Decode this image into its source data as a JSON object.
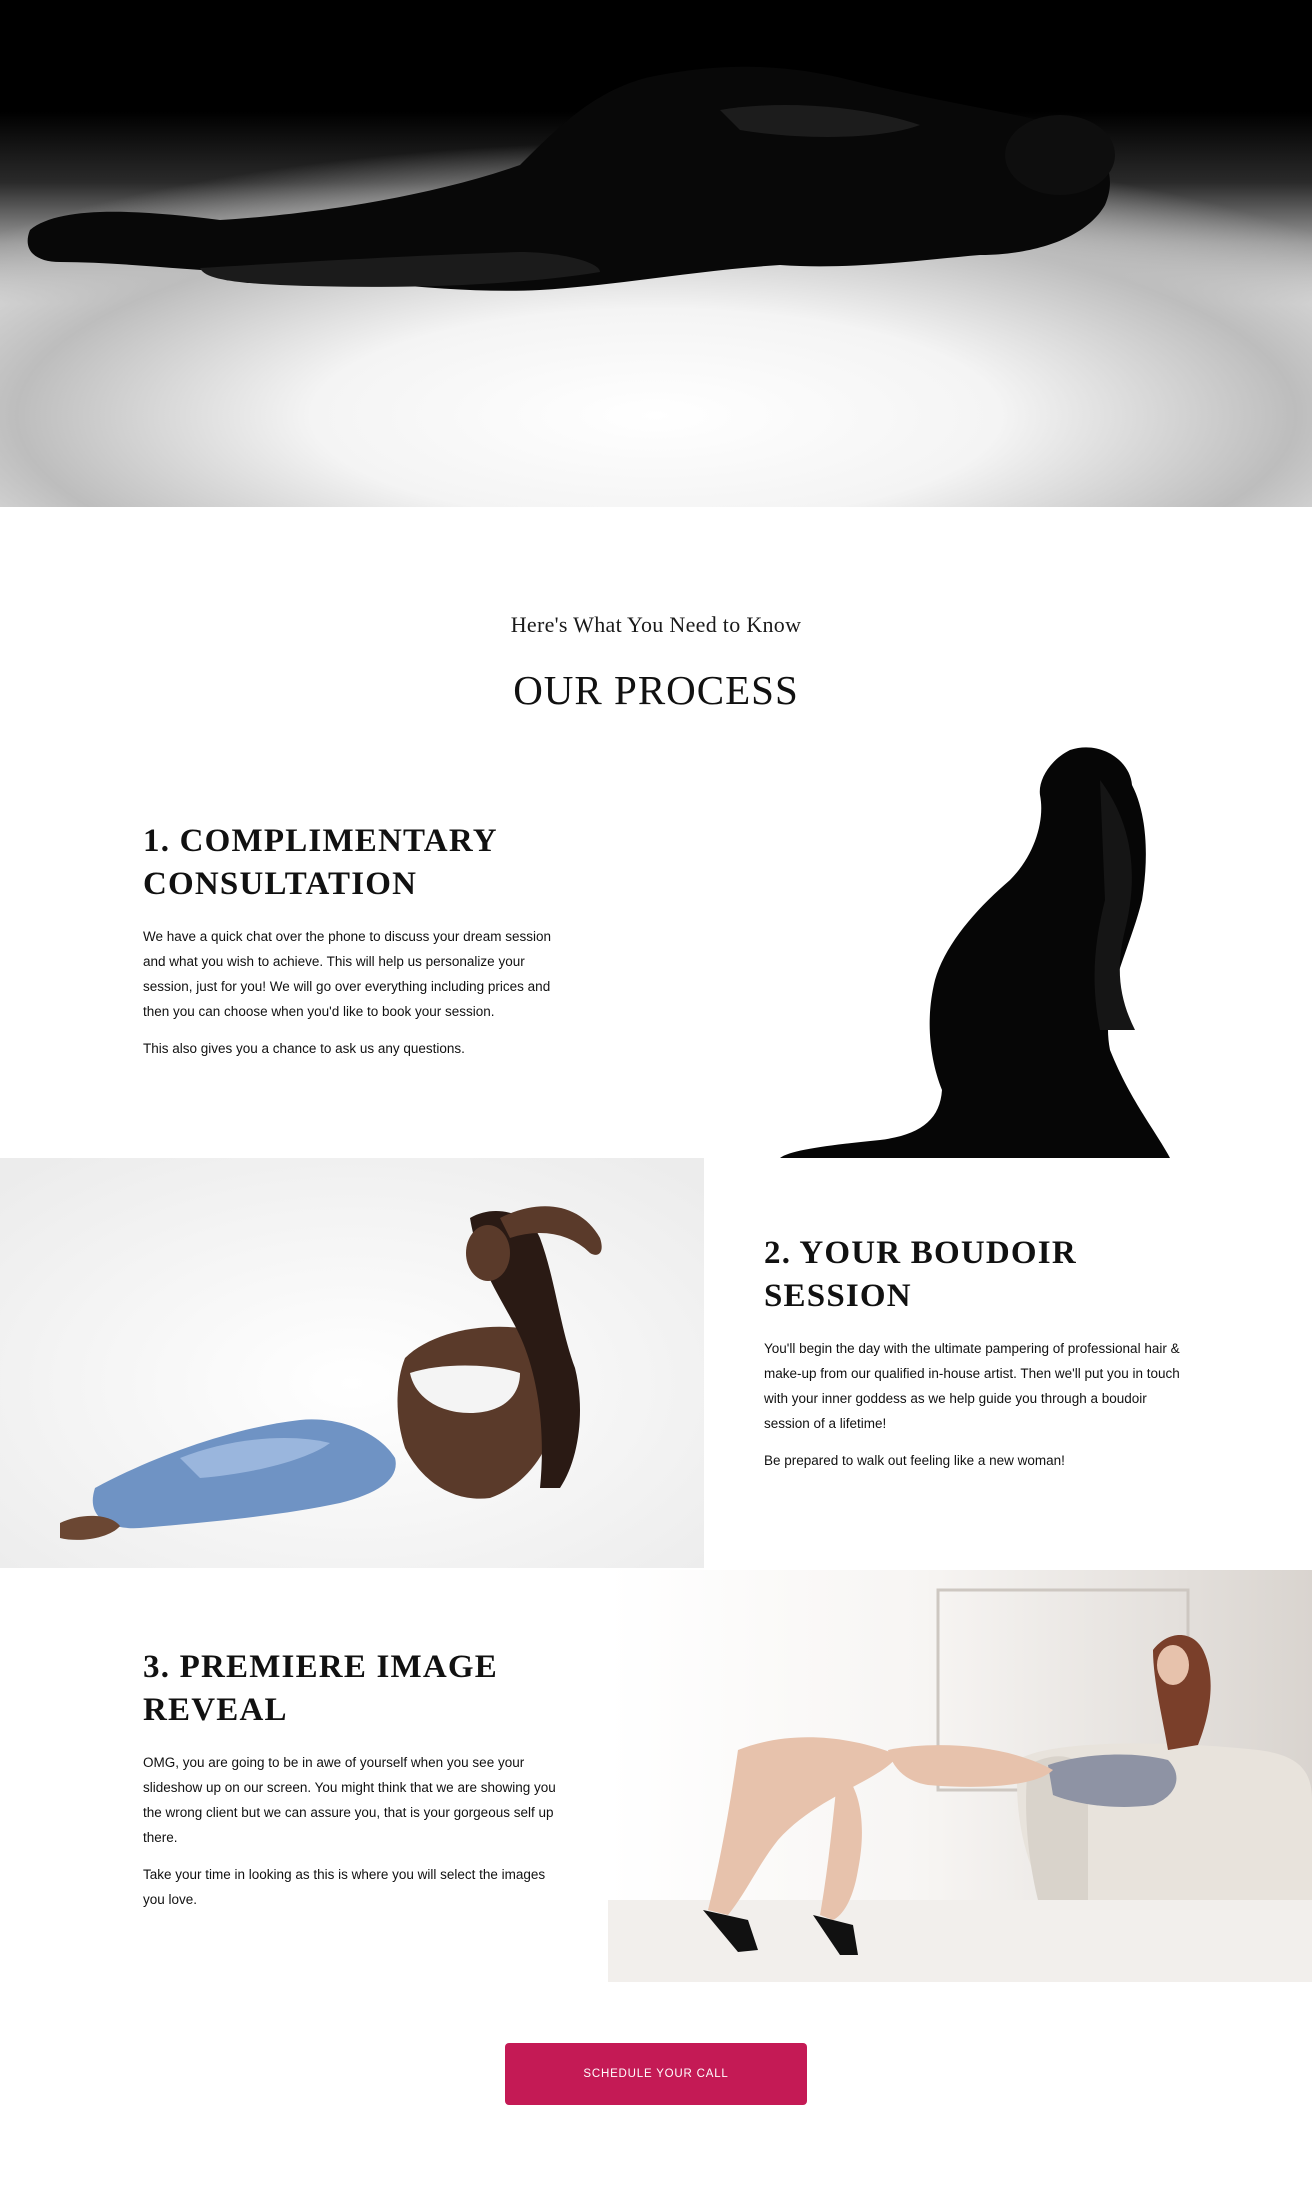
{
  "hero": {
    "image": "boudoir-hero-bw-photo"
  },
  "process": {
    "eyebrow": "Here's What You Need to Know",
    "title": "OUR PROCESS"
  },
  "steps": [
    {
      "title": "1. COMPLIMENTARY CONSULTATION",
      "paragraphs": [
        "We have a quick chat over the phone to discuss your dream session and what you wish to achieve. This will help us personalize your session, just for you! We will go over everything including prices and then you can choose when you'd like to book your session.",
        "This also gives you a chance to ask us any questions."
      ],
      "image": "silhouette-portrait-photo"
    },
    {
      "title": "2. YOUR BOUDOIR SESSION",
      "paragraphs": [
        "You'll begin the day with the ultimate pampering of professional hair & make-up from our qualified in-house artist.  Then we'll put you in touch with your inner goddess as we help guide you through a boudoir session of a lifetime!",
        "Be prepared to walk out feeling like a new woman!"
      ],
      "image": "reclining-jeans-portrait-photo"
    },
    {
      "title": "3. PREMIERE IMAGE REVEAL",
      "paragraphs": [
        "OMG, you are going to be in awe of yourself when you see your slideshow up on our screen. You might think that we are showing you the wrong client but we can assure you, that is your gorgeous self up there.",
        "Take your time in looking as this is where you will select the images you love."
      ],
      "image": "sofa-lace-bodysuit-photo"
    }
  ],
  "cta": {
    "label": "SCHEDULE YOUR CALL"
  },
  "colors": {
    "accent": "#c41a55",
    "text": "#111111",
    "background": "#ffffff"
  }
}
